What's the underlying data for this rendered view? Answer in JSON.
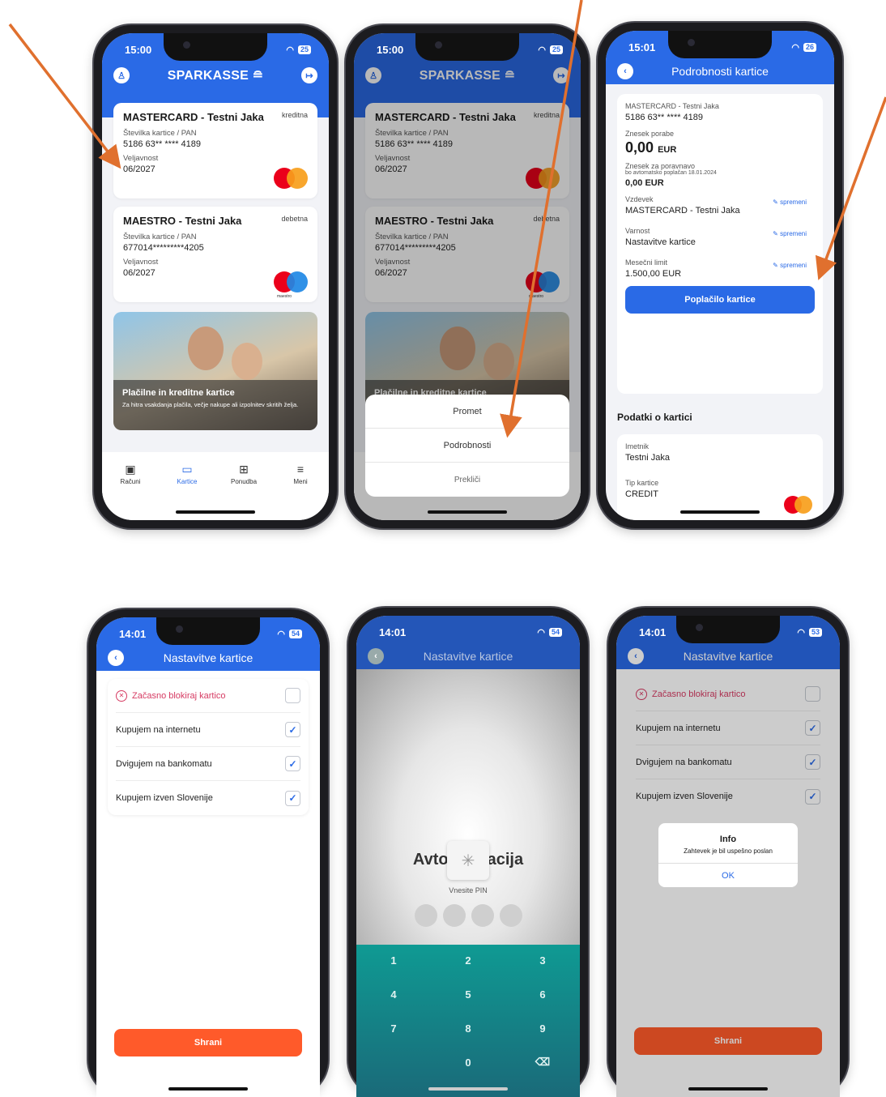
{
  "status": {
    "time1": "15:00",
    "time2": "15:00",
    "time3": "15:01",
    "time4": "14:01",
    "time5": "14:01",
    "time6": "14:01",
    "batt1": "25",
    "batt2": "25",
    "batt3": "26",
    "batt4": "54",
    "batt5": "54",
    "batt6": "53"
  },
  "brand": "SPARKASSE",
  "cards": [
    {
      "title": "MASTERCARD - Testni Jaka",
      "type": "kreditna",
      "pan_label": "Številka kartice / PAN",
      "pan": "5186 63** **** 4189",
      "exp_label": "Veljavnost",
      "exp": "06/2027"
    },
    {
      "title": "MAESTRO - Testni Jaka",
      "type": "debetna",
      "pan_label": "Številka kartice / PAN",
      "pan": "677014*********4205",
      "exp_label": "Veljavnost",
      "exp": "06/2027",
      "logo_text": "maestro"
    }
  ],
  "promo": {
    "title": "Plačilne in kreditne kartice",
    "subtitle": "Za hitra vsakdanja plačila, večje nakupe ali izpolnitev skritih želja."
  },
  "tabs": [
    "Računi",
    "Kartice",
    "Ponudba",
    "Meni"
  ],
  "sheet": {
    "opt1": "Promet",
    "opt2": "Podrobnosti",
    "cancel": "Prekliči"
  },
  "details": {
    "title": "Podrobnosti kartice",
    "card_name": "MASTERCARD - Testni Jaka",
    "pan": "5186 63** **** 4189",
    "spend_label": "Znesek porabe",
    "spend_value": "0,00",
    "spend_cur": "EUR",
    "settle_label": "Znesek za poravnavo",
    "settle_note": "bo avtomatsko poplačan 18.01.2024",
    "settle_value": "0,00 EUR",
    "nick_label": "Vzdevek",
    "nick_value": "MASTERCARD - Testni Jaka",
    "sec_label": "Varnost",
    "sec_value": "Nastavitve kartice",
    "limit_label": "Mesečni limit",
    "limit_value": "1.500,00 EUR",
    "edit": "spremeni",
    "pay_button": "Poplačilo kartice",
    "section": "Podatki o kartici",
    "holder_label": "Imetnik",
    "holder_value": "Testni Jaka",
    "ctype_label": "Tip kartice",
    "ctype_value": "CREDIT"
  },
  "settings": {
    "title": "Nastavitve kartice",
    "block": "Začasno blokiraj kartico",
    "internet": "Kupujem na internetu",
    "atm": "Dvigujem na bankomatu",
    "abroad": "Kupujem izven Slovenije",
    "save": "Shrani",
    "checked": {
      "block": false,
      "internet": true,
      "atm": true,
      "abroad": true
    }
  },
  "auth": {
    "title": "Avtorizacija",
    "title_left": "Avto",
    "title_right": "acija",
    "pin_label": "Vnesite PIN",
    "keys": [
      "1",
      "2",
      "3",
      "4",
      "5",
      "6",
      "7",
      "8",
      "9",
      "",
      "0",
      "⌫"
    ]
  },
  "alert": {
    "title": "Info",
    "message": "Zahtevek je bil uspešno poslan",
    "ok": "OK"
  },
  "icons": {
    "user": "user-icon",
    "logout": "logout-icon",
    "back": "back-icon",
    "pencil": "pencil-icon",
    "check": "check-icon",
    "spinner": "spinner-icon"
  },
  "colors": {
    "primary": "#2a6ae6",
    "save": "#ff5a2a",
    "danger": "#d63a62",
    "arrow": "#e0702e",
    "teal": "#0f9a93"
  }
}
